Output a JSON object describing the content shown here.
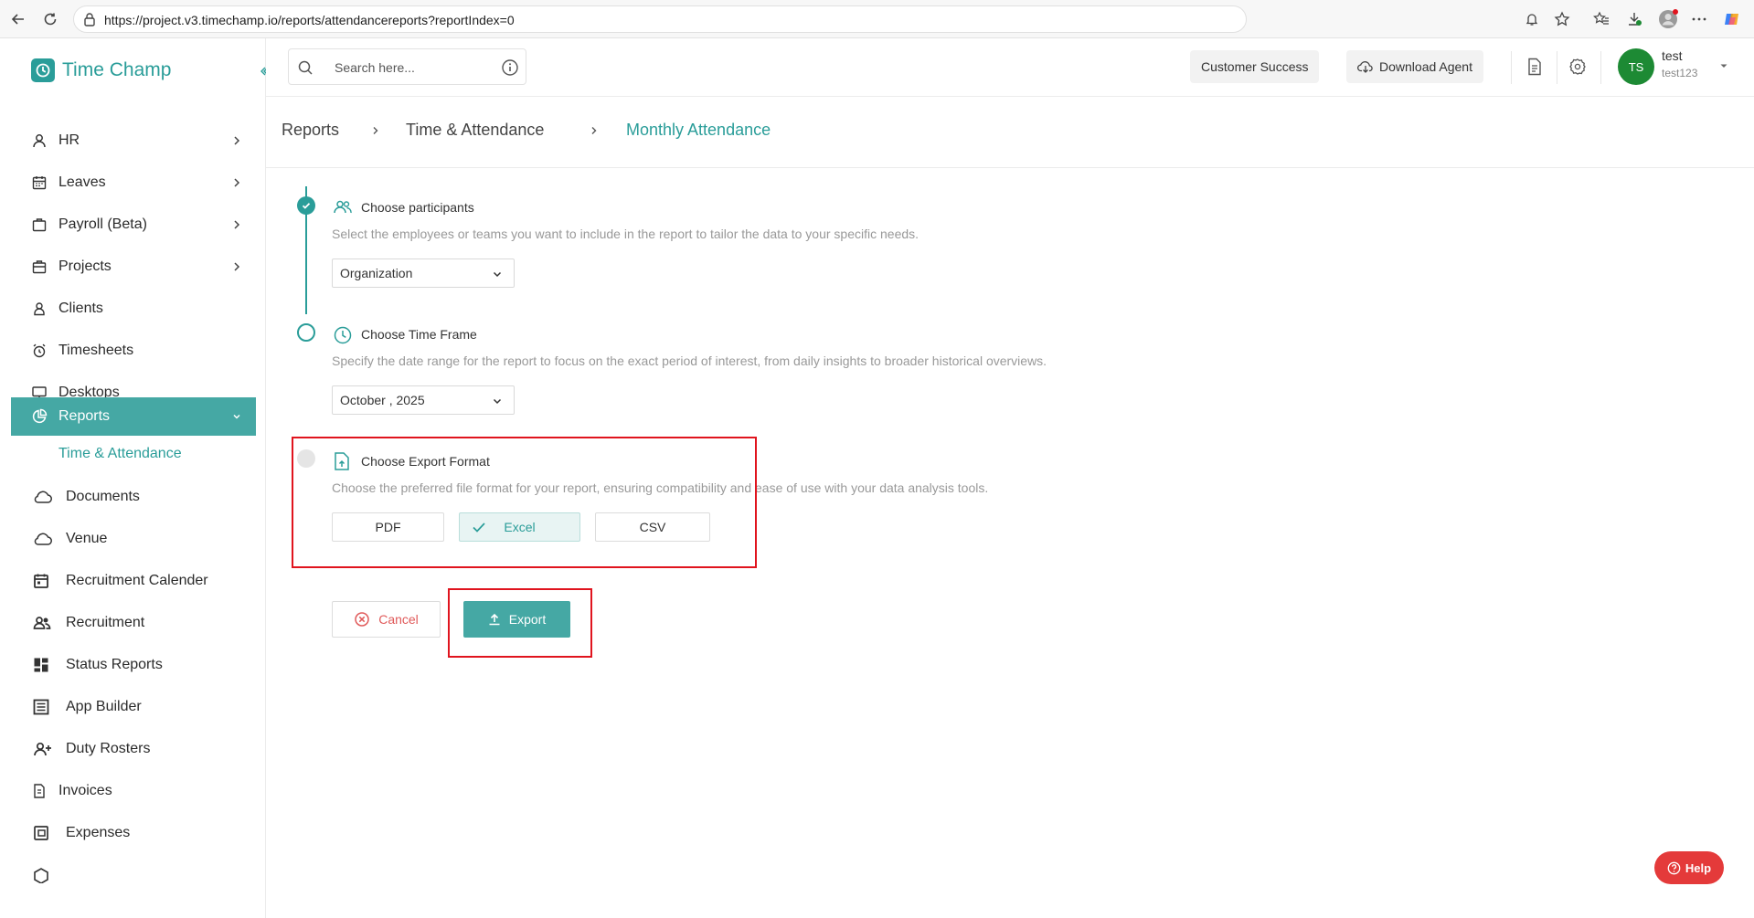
{
  "browser": {
    "url": "https://project.v3.timechamp.io/reports/attendancereports?reportIndex=0"
  },
  "app": {
    "logo_text": "Time Champ",
    "brand_color": "#2a9d99",
    "accent_color": "#45a8a4"
  },
  "sidebar": {
    "items": [
      {
        "label": "HR",
        "icon": "user-icon",
        "has_chevron": true
      },
      {
        "label": "Leaves",
        "icon": "calendar-icon",
        "has_chevron": true
      },
      {
        "label": "Payroll (Beta)",
        "icon": "briefcase-icon",
        "has_chevron": true
      },
      {
        "label": "Projects",
        "icon": "folder-icon",
        "has_chevron": true
      },
      {
        "label": "Clients",
        "icon": "person-icon",
        "has_chevron": false
      },
      {
        "label": "Timesheets",
        "icon": "alarm-clock-icon",
        "has_chevron": false
      },
      {
        "label": "Desktops",
        "icon": "monitor-icon",
        "has_chevron": false
      },
      {
        "label": "Reports",
        "icon": "pie-chart-icon",
        "has_chevron": true,
        "active": true
      },
      {
        "label": "Time & Attendance",
        "sub": true
      },
      {
        "label": "Documents",
        "icon": "cloud-icon"
      },
      {
        "label": "Venue",
        "icon": "cloud-icon"
      },
      {
        "label": "Recruitment Calender",
        "icon": "calendar-icon"
      },
      {
        "label": "Recruitment",
        "icon": "people-icon"
      },
      {
        "label": "Status Reports",
        "icon": "dashboard-icon"
      },
      {
        "label": "App Builder",
        "icon": "list-icon"
      },
      {
        "label": "Duty Rosters",
        "icon": "user-add-icon"
      },
      {
        "label": "Invoices",
        "icon": "document-icon"
      },
      {
        "label": "Expenses",
        "icon": "wallet-icon"
      }
    ]
  },
  "header": {
    "search_placeholder": "Search here...",
    "customer_success": "Customer Success",
    "download_agent": "Download Agent",
    "avatar_initials": "TS",
    "user_name": "test",
    "user_id": "test123"
  },
  "breadcrumb": {
    "items": [
      "Reports",
      "Time & Attendance",
      "Monthly Attendance"
    ]
  },
  "steps": {
    "participants": {
      "title": "Choose participants",
      "description": "Select the employees or teams you want to include in the report to tailor the data to your specific needs.",
      "value": "Organization"
    },
    "timeframe": {
      "title": "Choose Time Frame",
      "description": "Specify the date range for the report to focus on the exact period of interest, from daily insights to broader historical overviews.",
      "value": "October , 2025"
    },
    "export_format": {
      "title": "Choose Export Format",
      "description": "Choose the preferred file format for your report, ensuring compatibility and ease of use with your data analysis tools.",
      "options": [
        "PDF",
        "Excel",
        "CSV"
      ],
      "selected": "Excel"
    }
  },
  "actions": {
    "cancel": "Cancel",
    "export": "Export"
  },
  "help": {
    "label": "Help"
  },
  "annotation_color": "#e0141e"
}
